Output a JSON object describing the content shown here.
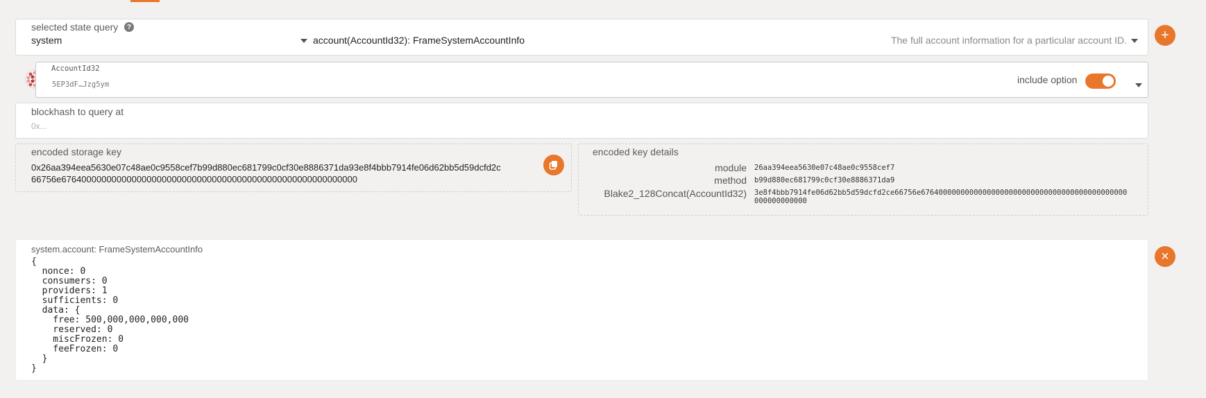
{
  "query": {
    "label": "selected state query",
    "help_icon": "question-mark-icon",
    "module": "system",
    "method": "account(AccountId32): FrameSystemAccountInfo",
    "description": "The full account information for a particular account ID."
  },
  "account": {
    "label": "AccountId32",
    "value": "5EP3dF…Jzg5ym",
    "include_option_label": "include option",
    "include_option_on": true
  },
  "blockhash": {
    "label": "blockhash to query at",
    "placeholder": "0x..."
  },
  "encoded_key": {
    "label": "encoded storage key",
    "line1": "0x26aa394eea5630e07c48ae0c9558cef7b99d880ec681799c0cf30e8886371da93e8f4bbb7914fe06d62bb5d59dcfd2c",
    "line2": "66756e67640000000000000000000000000000000000000000000000000000000"
  },
  "key_details": {
    "label": "encoded key details",
    "rows": [
      {
        "key": "module",
        "value": "26aa394eea5630e07c48ae0c9558cef7"
      },
      {
        "key": "method",
        "value": "b99d880ec681799c0cf30e8886371da9"
      },
      {
        "key": "Blake2_128Concat(AccountId32)",
        "value": "3e8f4bbb7914fe06d62bb5d59dcfd2ce66756e67640000000000000000000000000000000000000000000000000000000"
      }
    ]
  },
  "result": {
    "label": "system.account: FrameSystemAccountInfo",
    "body": "{\n  nonce: 0\n  consumers: 0\n  providers: 1\n  sufficients: 0\n  data: {\n    free: 500,000,000,000,000\n    reserved: 0\n    miscFrozen: 0\n    feeFrozen: 0\n  }\n}"
  },
  "buttons": {
    "add": "+",
    "close": "×"
  },
  "colors": {
    "accent": "#e8762b",
    "background": "#f2f1f0"
  }
}
